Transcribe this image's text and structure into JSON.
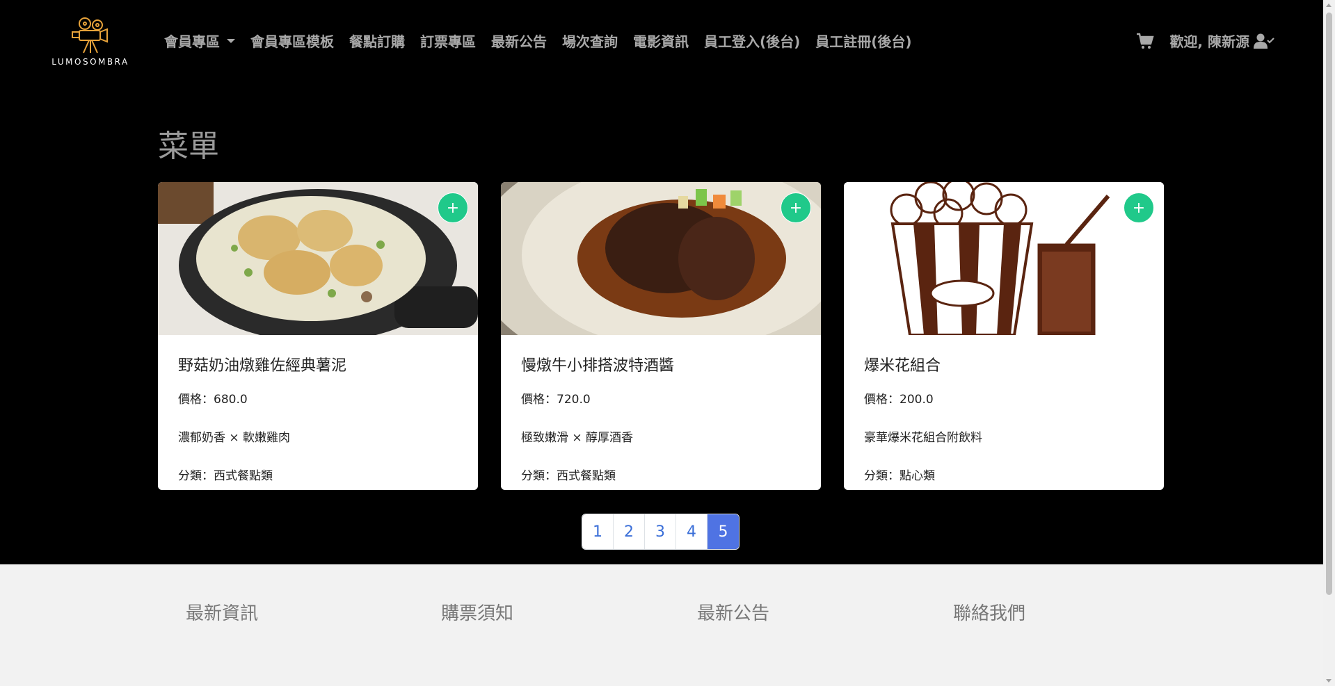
{
  "brand": {
    "name": "LUMOSOMBRA"
  },
  "nav": {
    "items": [
      {
        "label": "會員專區",
        "dropdown": true
      },
      {
        "label": "會員專區模板"
      },
      {
        "label": "餐點訂購"
      },
      {
        "label": "訂票專區"
      },
      {
        "label": "最新公告"
      },
      {
        "label": "場次查詢"
      },
      {
        "label": "電影資訊"
      },
      {
        "label": "員工登入(後台)"
      },
      {
        "label": "員工註冊(後台)"
      }
    ],
    "welcome": "歡迎, 陳新源",
    "cart_icon": "shopping-cart-icon",
    "user_icon": "user-check-icon"
  },
  "main": {
    "title": "菜單",
    "add_label": "+",
    "cards": [
      {
        "name": "野菇奶油燉雞佐經典薯泥",
        "price": "價格：680.0",
        "desc": "濃郁奶香 × 軟嫩雞肉",
        "category": "分類：西式餐點類"
      },
      {
        "name": "慢燉牛小排搭波特酒醬",
        "price": "價格：720.0",
        "desc": "極致嫩滑 × 醇厚酒香",
        "category": "分類：西式餐點類"
      },
      {
        "name": "爆米花組合",
        "price": "價格：200.0",
        "desc": "豪華爆米花組合附飲料",
        "category": "分類：點心類"
      }
    ]
  },
  "pagination": {
    "pages": [
      "1",
      "2",
      "3",
      "4",
      "5"
    ],
    "active": "5"
  },
  "footer": {
    "columns": [
      "最新資訊",
      "購票須知",
      "最新公告",
      "聯絡我們"
    ]
  },
  "colors": {
    "accent": "#20c98a",
    "pagination_active": "#4f73e3",
    "logo": "#e8a33a"
  }
}
